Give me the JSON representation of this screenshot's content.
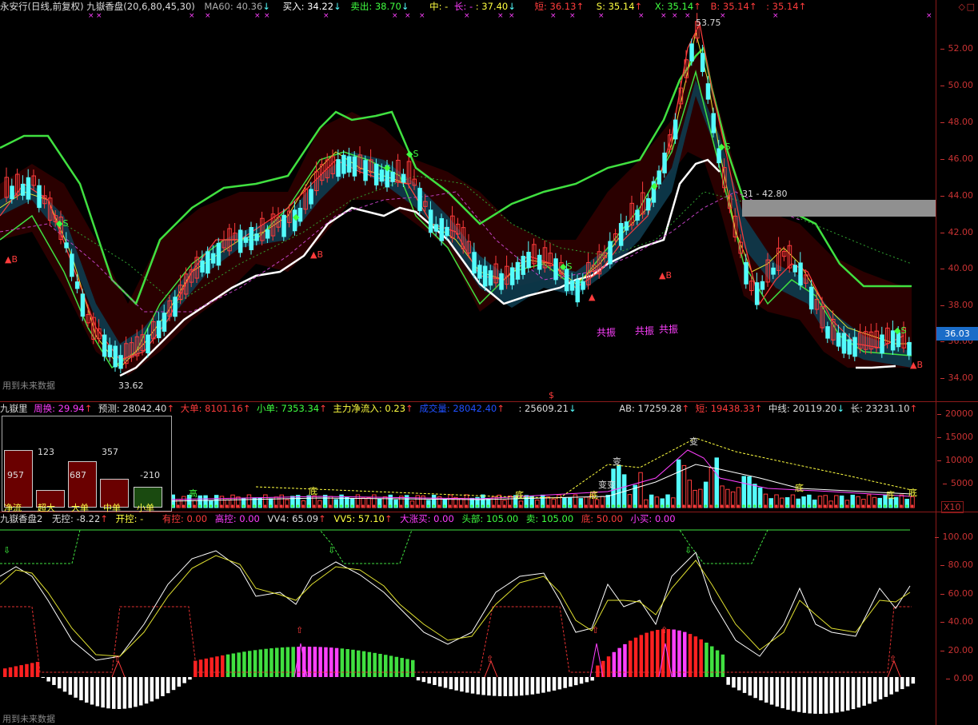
{
  "main_header": {
    "title": "永安行(日线,前复权)",
    "indicator": "九嶽香盘(20,6,80,45,30)",
    "ma60": "MA60: 40.36",
    "buy": "买入: 34.22",
    "sell": "卖出: 38.70",
    "mid": "中: -",
    "long": "长: -",
    "v3740": ": 37.40",
    "short": "短: 36.13",
    "s": "S: 35.14",
    "x": "X: 35.14",
    "b": "B: 35.14",
    "b2": ": 35.14"
  },
  "main_axis": [
    "52.00",
    "50.00",
    "48.00",
    "46.00",
    "44.00",
    "42.00",
    "40.00",
    "38.00",
    "36.00",
    "34.00"
  ],
  "main_annotations": {
    "high": "53.75",
    "low": "33.62",
    "band": "31 - 42.80",
    "price_tag": "36.03",
    "gongzhen": [
      "共振",
      "共振",
      "共振"
    ],
    "future_note": "用到未来数据"
  },
  "vol_header": {
    "name": "九嶽里",
    "turnover": "周换: 29.94",
    "forecast": "预测: 28042.40",
    "big": "大单: 8101.16",
    "small": "小单: 7353.34",
    "netflow": "主力净流入: 0.23",
    "volume": "成交量: 28042.40",
    "v25609": ": 25609.21",
    "ab": "AB: 17259.28",
    "short": "短: 19438.33",
    "mid": "中线: 20119.20",
    "long": "长: 23231.10"
  },
  "vol_axis": [
    "20000",
    "15000",
    "10000",
    "5000"
  ],
  "vol_unit": "X10",
  "flow_box": {
    "bars": [
      {
        "label": "净流",
        "value": "957"
      },
      {
        "label": "超大",
        "value": "123"
      },
      {
        "label": "大单",
        "value": "687"
      },
      {
        "label": "中单",
        "value": "357"
      },
      {
        "label": "小单",
        "value": "-210"
      }
    ]
  },
  "osc_header": {
    "name": "九嶽香盘2",
    "wukong": "无控: -8.22",
    "kaikong": "开控: -",
    "youkong": "有控: 0.00",
    "gaokong": "高控: 0.00",
    "vv4": "VV4: 65.09",
    "vv5": "VV5: 57.10",
    "dazhang": "大涨买: 0.00",
    "toubu": "头部: 105.00",
    "mai": "卖: 105.00",
    "di": "底: 50.00",
    "xiaomai": "小买: 0.00"
  },
  "osc_axis": [
    "100.00",
    "80.00",
    "60.00",
    "40.00",
    "20.00",
    "0.00"
  ],
  "osc_note": "用到未来数据",
  "colors": {
    "up": "#ff3c3c",
    "down": "#54fcfc",
    "grid": "#8b1a1a"
  }
}
